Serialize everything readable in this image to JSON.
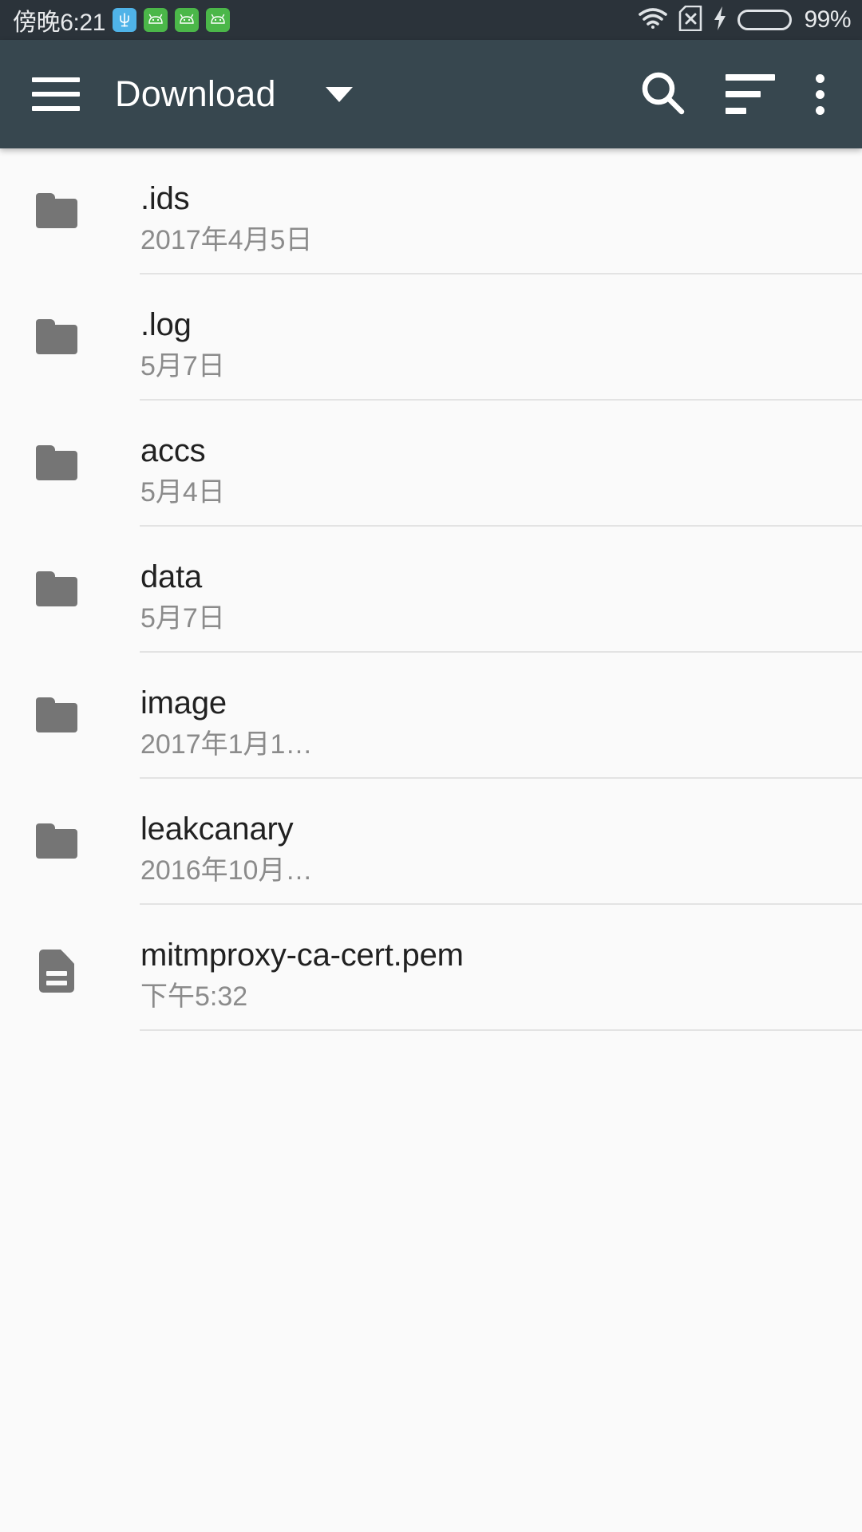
{
  "status_bar": {
    "time": "傍晚6:21",
    "battery_percent": "99%",
    "battery_level": 99,
    "notification_icons": [
      {
        "name": "trident-app-icon",
        "glyph": "Ψ",
        "color": "#4fb3e8"
      },
      {
        "name": "android-robot-icon-1",
        "glyph": "◕",
        "color": "#4bb749"
      },
      {
        "name": "android-robot-icon-2",
        "glyph": "◕",
        "color": "#4bb749"
      },
      {
        "name": "android-robot-icon-3",
        "glyph": "◕",
        "color": "#4bb749"
      }
    ],
    "system_icons": [
      "wifi-icon",
      "sim-card-missing-icon",
      "charging-bolt-icon",
      "battery-icon"
    ],
    "colors": {
      "background": "#2b333a",
      "text": "#e8eaec",
      "battery_fill": "#2fbf1f"
    }
  },
  "toolbar": {
    "title": "Download",
    "menu_label": "Navigation menu",
    "dropdown_label": "Change directory",
    "search_label": "Search",
    "sort_label": "Sort",
    "overflow_label": "More options",
    "colors": {
      "background": "#37474F",
      "text": "#ffffff"
    }
  },
  "file_list": {
    "items": [
      {
        "name": ".ids",
        "date": "2017年4月5日",
        "type": "folder"
      },
      {
        "name": ".log",
        "date": "5月7日",
        "type": "folder"
      },
      {
        "name": "accs",
        "date": "5月4日",
        "type": "folder"
      },
      {
        "name": "data",
        "date": "5月7日",
        "type": "folder"
      },
      {
        "name": "image",
        "date": "2017年1月1…",
        "type": "folder"
      },
      {
        "name": "leakcanary",
        "date": "2016年10月…",
        "type": "folder"
      },
      {
        "name": "mitmproxy-ca-cert.pem",
        "date": "下午5:32",
        "type": "file"
      }
    ],
    "colors": {
      "background": "#fafafa",
      "name_text": "#212121",
      "date_text": "#8b8b8b",
      "divider": "#e3e3e3",
      "icon": "#757575"
    }
  }
}
